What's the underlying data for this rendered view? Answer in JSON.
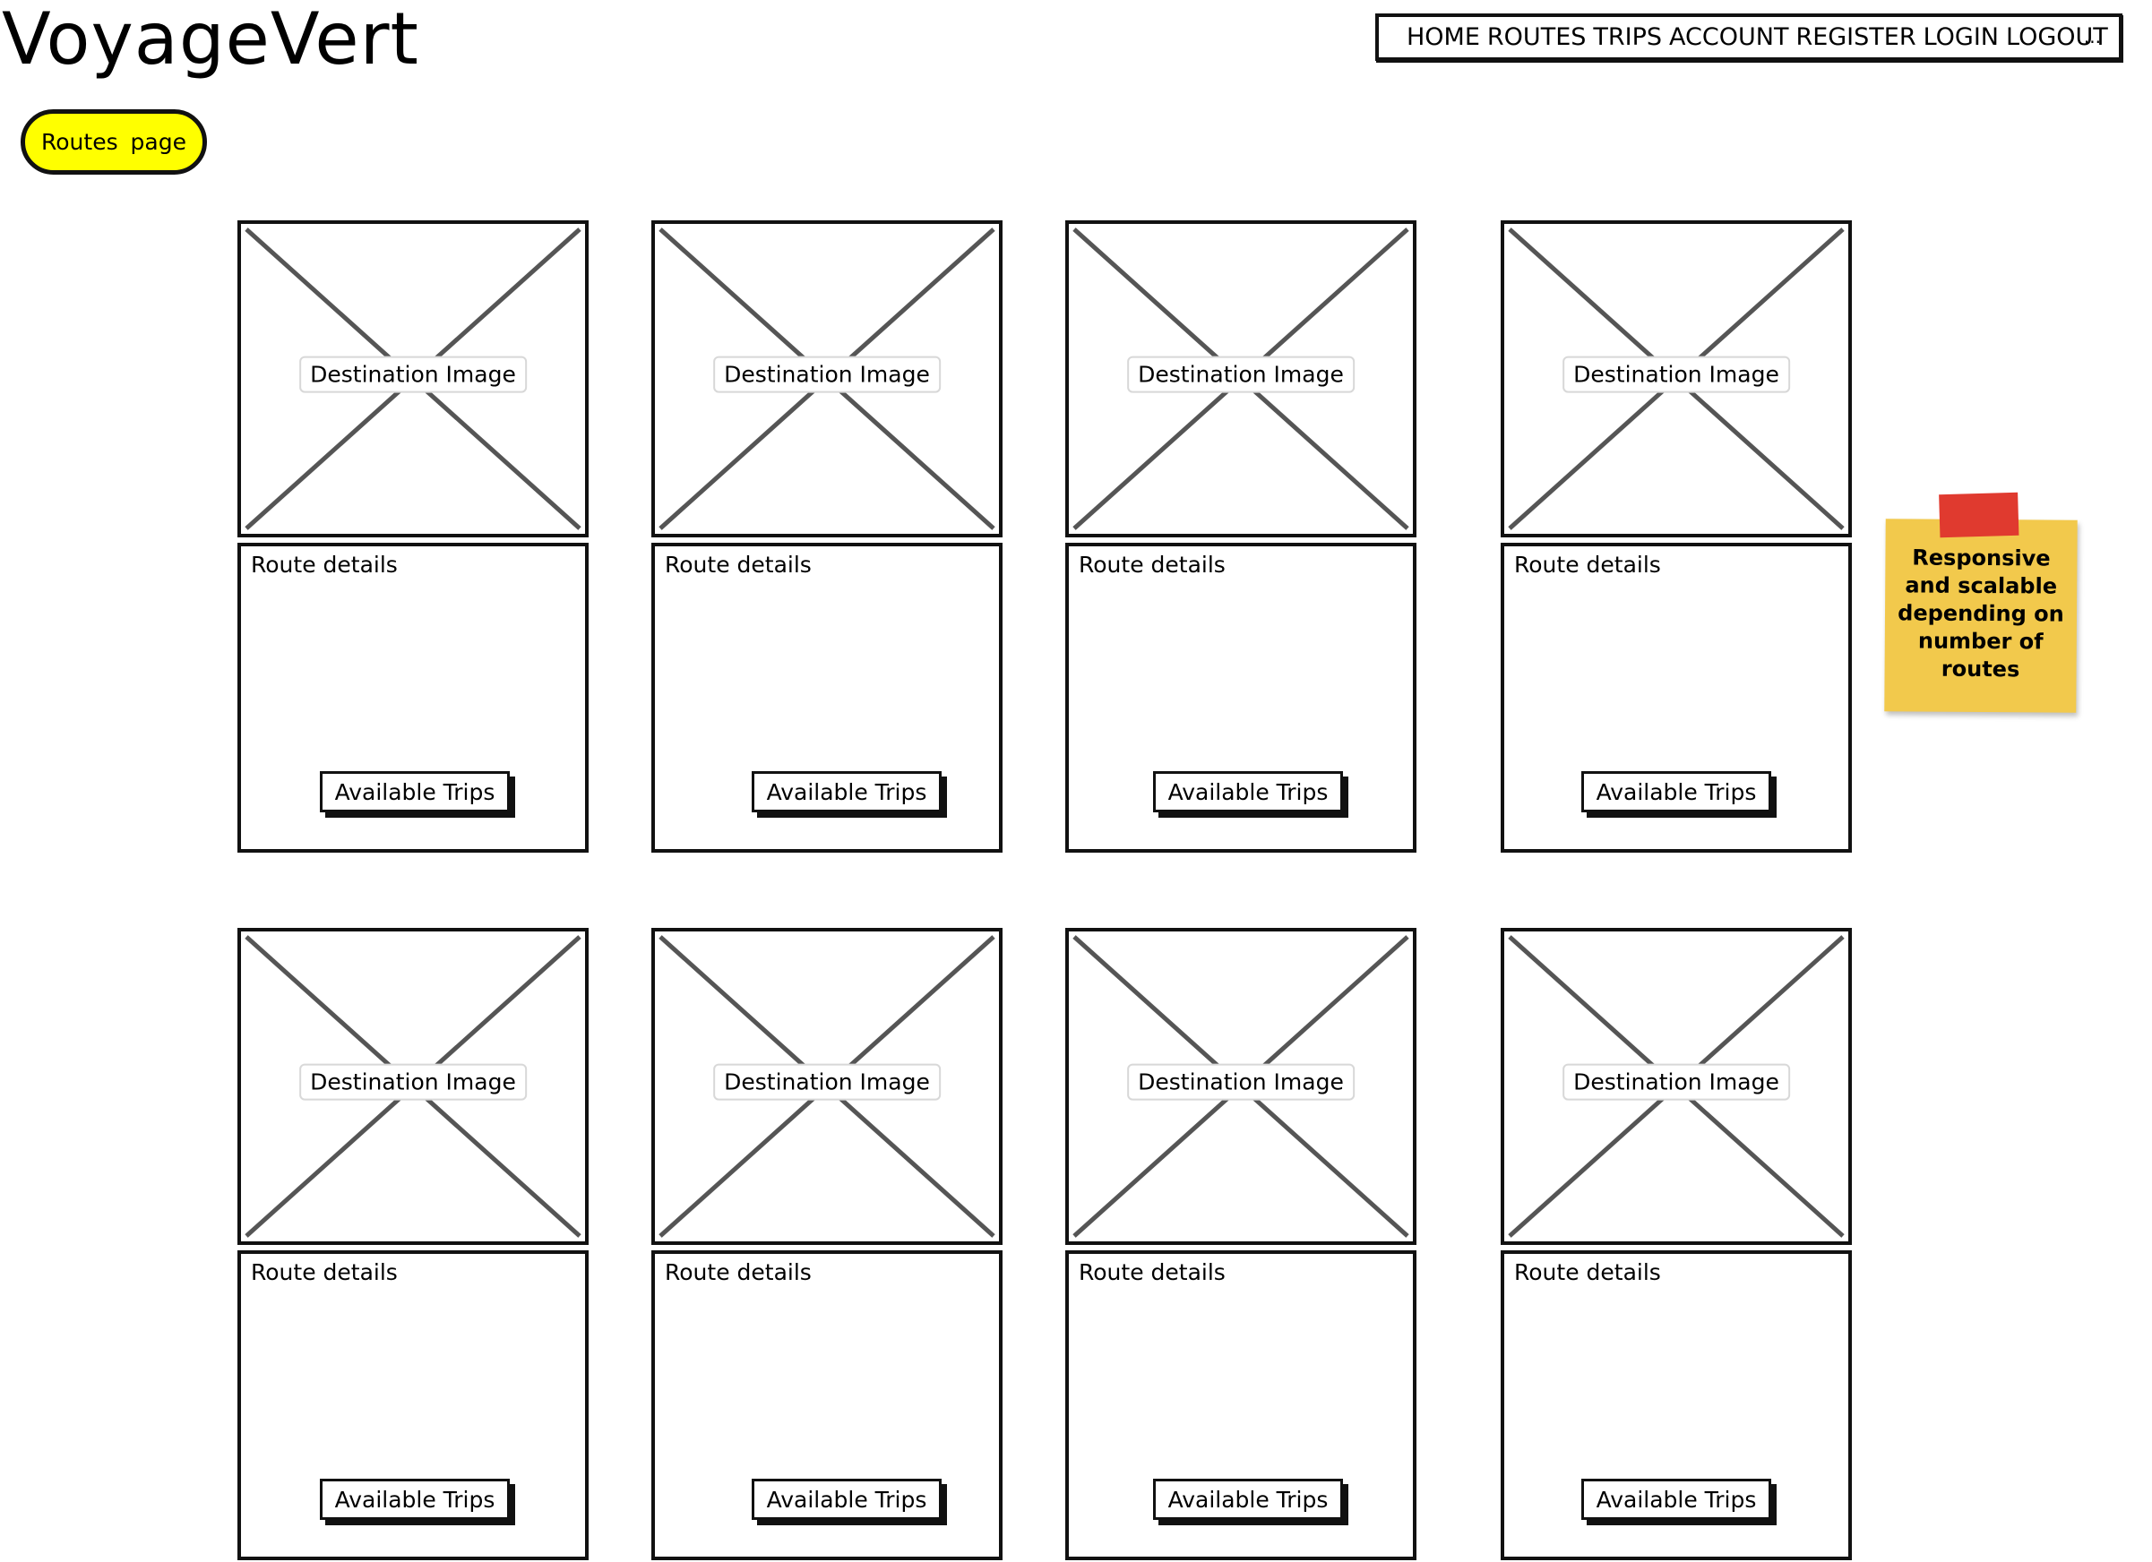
{
  "app": {
    "logo": "VoyageVert"
  },
  "nav": {
    "items": [
      "HOME",
      "ROUTES",
      "TRIPS",
      "ACCOUNT",
      "REGISTER",
      "LOGIN",
      "LOGOUT"
    ],
    "more": "..."
  },
  "page_badge": "Routes  page",
  "cards": [
    {
      "image_label": "Destination Image",
      "details_label": "Route details",
      "button_label": "Available Trips"
    },
    {
      "image_label": "Destination Image",
      "details_label": "Route details",
      "button_label": "Available Trips"
    },
    {
      "image_label": "Destination Image",
      "details_label": "Route details",
      "button_label": "Available Trips"
    },
    {
      "image_label": "Destination Image",
      "details_label": "Route details",
      "button_label": "Available Trips"
    },
    {
      "image_label": "Destination Image",
      "details_label": "Route details",
      "button_label": "Available Trips"
    },
    {
      "image_label": "Destination Image",
      "details_label": "Route details",
      "button_label": "Available Trips"
    },
    {
      "image_label": "Destination Image",
      "details_label": "Route details",
      "button_label": "Available Trips"
    },
    {
      "image_label": "Destination Image",
      "details_label": "Route details",
      "button_label": "Available Trips"
    }
  ],
  "sticky_note": {
    "text": "Responsive and scalable depending on number of routes",
    "note_color": "#f2c94c",
    "tape_color": "#e03a2f"
  },
  "colors": {
    "badge": "#ffff00",
    "stroke": "#111111",
    "placeholder_cross": "#555555"
  },
  "icons": {
    "image_placeholder": "image-placeholder-icon"
  }
}
